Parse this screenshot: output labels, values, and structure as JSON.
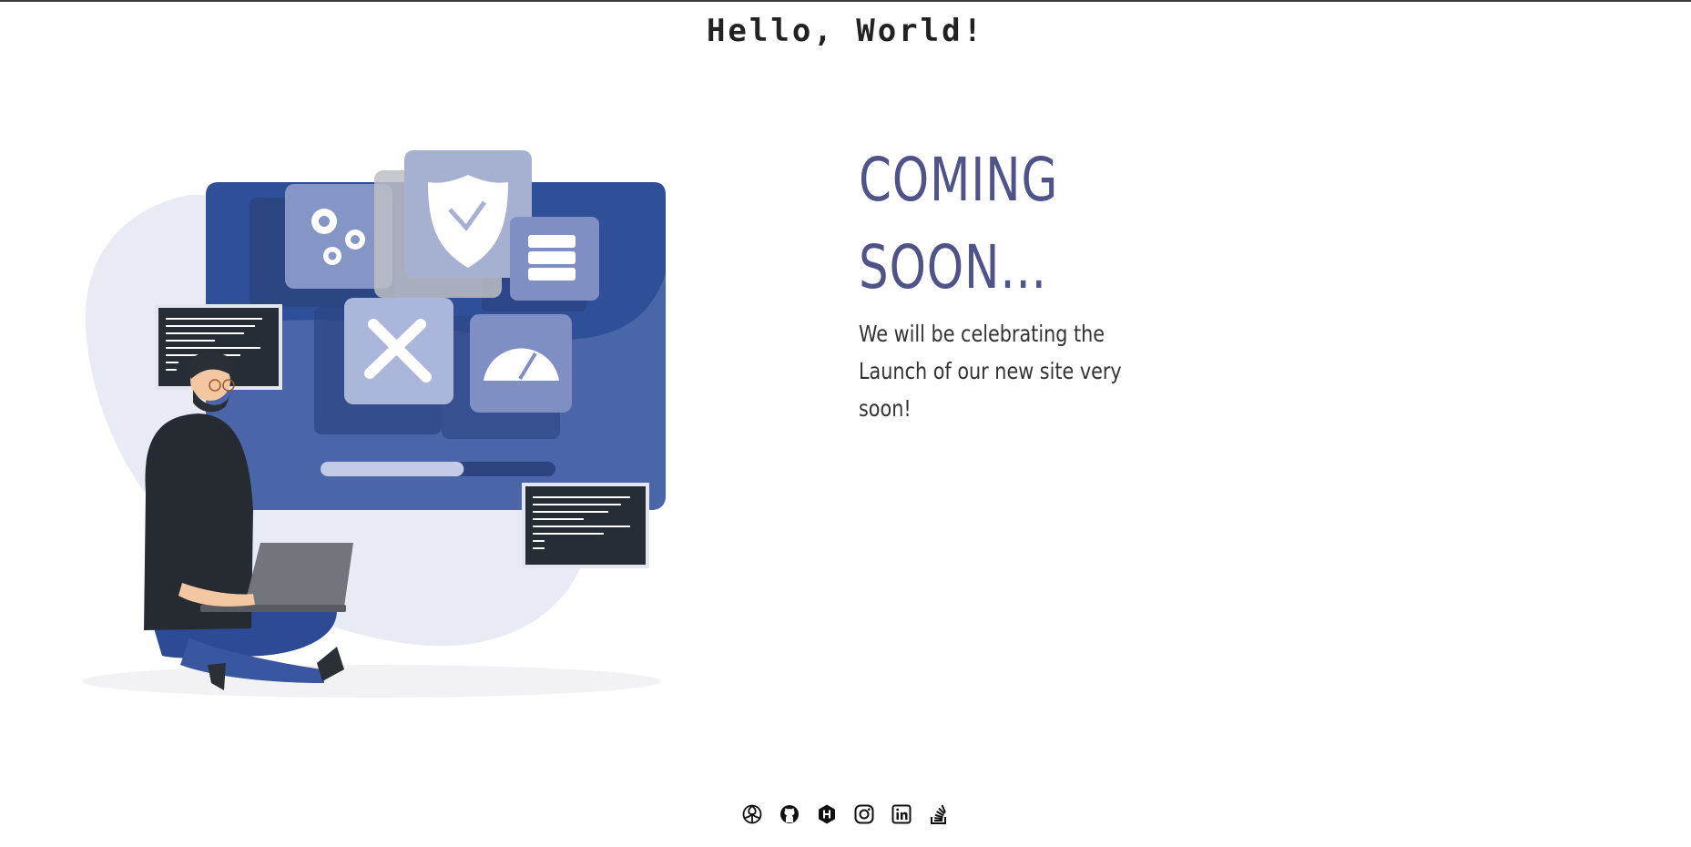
{
  "header": {
    "title": "Hello, World!"
  },
  "hero": {
    "heading_line1": "COMING",
    "heading_line2": "SOON...",
    "message": "We will be celebrating the Launch of our new site very soon!",
    "progress_fraction": 0.61
  },
  "social": {
    "links": [
      {
        "icon": "openai-icon"
      },
      {
        "icon": "github-icon"
      },
      {
        "icon": "hackerrank-icon"
      },
      {
        "icon": "instagram-icon"
      },
      {
        "icon": "linkedin-icon"
      },
      {
        "icon": "stackoverflow-icon"
      }
    ]
  },
  "colors": {
    "heading": "#4f5388",
    "panel_blue": "#3656a0",
    "blob": "#e9ebf4",
    "title": "#222222"
  }
}
